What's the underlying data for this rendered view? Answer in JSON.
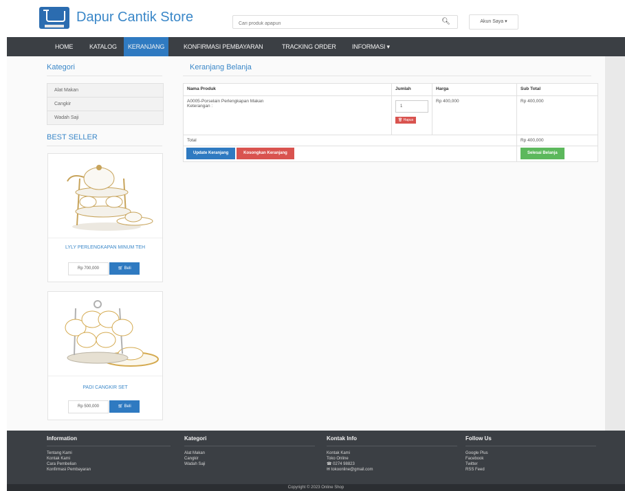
{
  "header": {
    "brand": "Dapur Cantik Store",
    "search_placeholder": "Cari produk apapun",
    "account_label": "Akun Saya ▾"
  },
  "nav": {
    "items": [
      {
        "label": "HOME"
      },
      {
        "label": "KATALOG"
      },
      {
        "label": "KERANJANG",
        "active": true
      },
      {
        "label": "KONFIRMASI PEMBAYARAN"
      },
      {
        "label": "TRACKING ORDER"
      },
      {
        "label": "INFORMASI ▾"
      }
    ]
  },
  "sidebar": {
    "category_title": "Kategori",
    "categories": [
      "Alat Makan",
      "Cangkir",
      "Wadah Saji"
    ],
    "bestseller_title": "BEST SELLER",
    "products": [
      {
        "name": "LYLY PERLENGKAPAN MINUM TEH",
        "price": "Rp 700,000",
        "buy_label": "Beli"
      },
      {
        "name": "PADI CANGKIR SET",
        "price": "Rp 500,000",
        "buy_label": "Beli"
      }
    ]
  },
  "cart": {
    "title": "Keranjang Belanja",
    "headers": [
      "Nama Produk",
      "Jumlah",
      "Harga",
      "Sub Total"
    ],
    "rows": [
      {
        "name": "A0005-Porselain Perlengkapan Makan",
        "note": "Keterangan :",
        "qty": "1",
        "remove_label": "Hapus",
        "price": "Rp 400,000",
        "subtotal": "Rp 400,000"
      }
    ],
    "total_label": "Total",
    "total_value": "Rp 400,000",
    "update_label": "Update Keranjang",
    "empty_label": "Kosongkan Keranjang",
    "checkout_label": "Selesai Belanja"
  },
  "footer": {
    "columns": [
      {
        "title": "Information",
        "items": [
          "Tentang Kami",
          "Kontak Kami",
          "Cara Pembelian",
          "Konfirmasi Pembayaran"
        ]
      },
      {
        "title": "Kategori",
        "items": [
          "Alat Makan",
          "Cangkir",
          "Wadah Saji"
        ]
      },
      {
        "title": "Kontak Info",
        "items": [
          "Kontak Kami",
          "Toko Online",
          "0274 98823",
          "tokoonline@gmail.com"
        ]
      },
      {
        "title": "Follow Us",
        "items": [
          "Google Plus",
          "Facebook",
          "Twitter",
          "RSS Feed"
        ]
      }
    ],
    "copyright": "Copyright © 2023 Online Shop"
  },
  "colors": {
    "accent": "#3a87c8",
    "nav_bg": "#3b3f44",
    "btn_blue": "#2f7ac1",
    "btn_red": "#d9534f",
    "btn_green": "#5cb85c"
  }
}
